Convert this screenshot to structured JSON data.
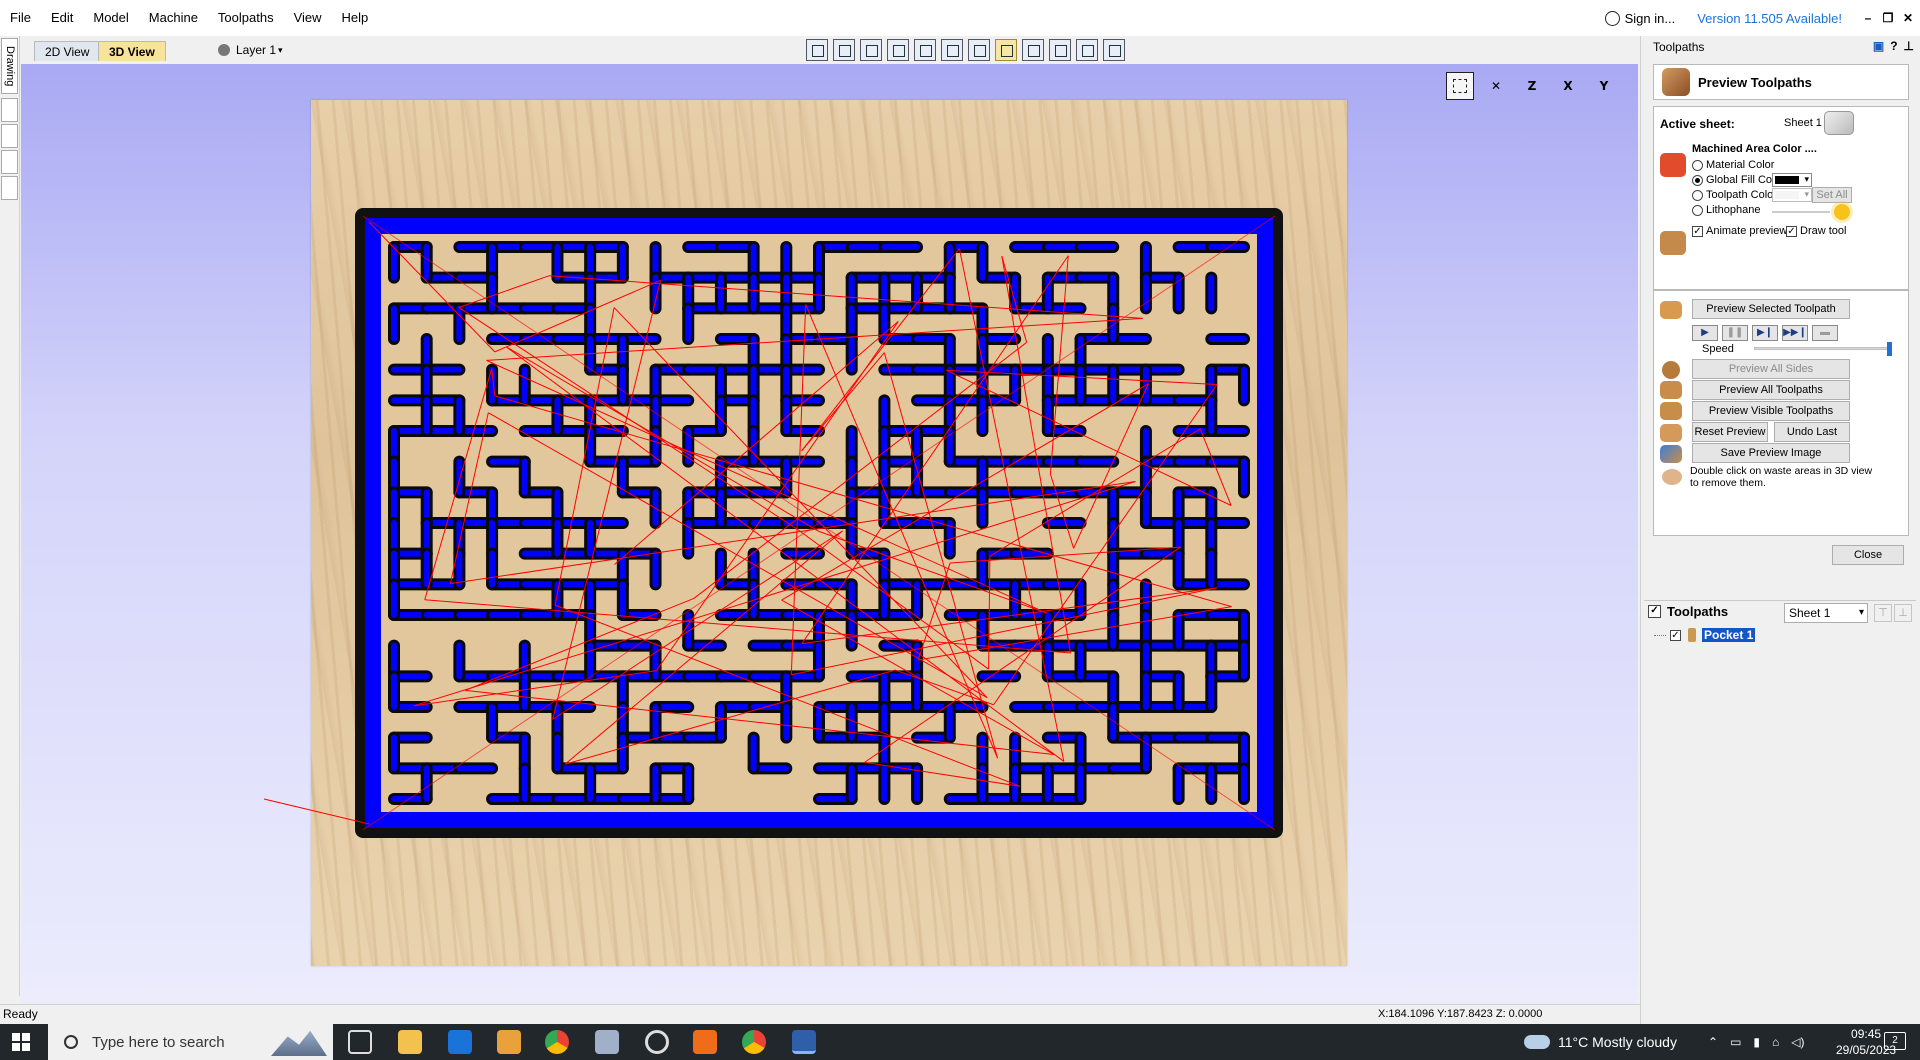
{
  "menu": [
    "File",
    "Edit",
    "Model",
    "Machine",
    "Toolpaths",
    "View",
    "Help"
  ],
  "header": {
    "sign_in": "Sign in...",
    "version": "Version 11.505 Available!"
  },
  "left_strip": {
    "drawing_tab": "Drawing"
  },
  "view_tabs": {
    "tab_2d": "2D View",
    "tab_3d": "3D View",
    "layer": "Layer 1"
  },
  "view_icons": [
    "zoom-extents",
    "iso-view",
    "z-view",
    "x-view",
    "y-view"
  ],
  "panel": {
    "title": "Toolpaths",
    "preview_title": "Preview Toolpaths",
    "active_sheet_label": "Active sheet:",
    "active_sheet_value": "Sheet 1",
    "machined_area_label": "Machined Area Color ....",
    "options": {
      "material_color": "Material Color",
      "global_fill_color": "Global Fill Color",
      "toolpath_color": "Toolpath Color",
      "lithophane": "Lithophane"
    },
    "set_all": "Set All",
    "animate_preview": "Animate preview",
    "draw_tool": "Draw tool",
    "buttons": {
      "preview_selected": "Preview Selected Toolpath",
      "speed": "Speed",
      "preview_all_sides": "Preview All Sides",
      "preview_all_toolpaths": "Preview All Toolpaths",
      "preview_visible_toolpaths": "Preview Visible Toolpaths",
      "reset_preview": "Reset Preview",
      "undo_last": "Undo Last",
      "save_preview_image": "Save Preview Image",
      "close": "Close"
    },
    "hint_line1": "Double click on waste areas in 3D view",
    "hint_line2": "to remove them.",
    "speed_value": 1.0,
    "colors": {
      "global_fill": "#000000",
      "machined_fill": "#0000ff",
      "toolpath_line": "#ff0000"
    }
  },
  "toolpath_list": {
    "header": "Toolpaths",
    "sheet_select": "Sheet 1",
    "items": [
      "Pocket 1"
    ]
  },
  "status": {
    "text": "Ready",
    "coords": "X:184.1096 Y:187.8423 Z:  0.0000"
  },
  "taskbar": {
    "search_placeholder": "Type here to search",
    "weather": "11°C  Mostly cloudy",
    "time": "09:45",
    "date": "29/05/2023",
    "notifications": "2"
  }
}
